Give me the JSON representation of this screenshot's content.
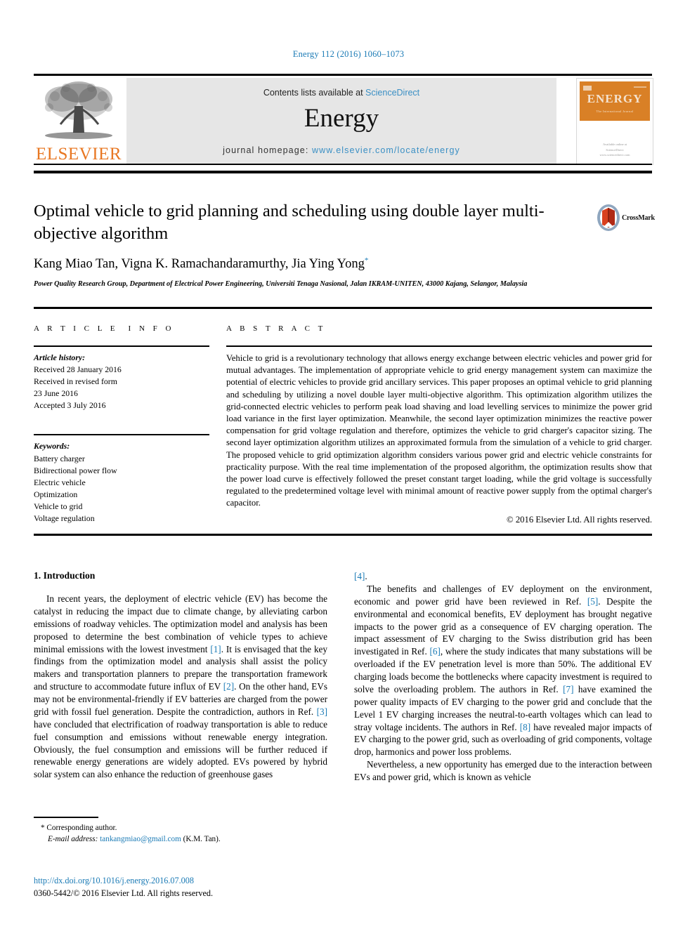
{
  "running_head": "Energy 112 (2016) 1060–1073",
  "masthead": {
    "publisher_name": "ELSEVIER",
    "contents_prefix": "Contents lists available at ",
    "sciencedirect": "ScienceDirect",
    "journal_title": "Energy",
    "homepage_prefix": "journal homepage: ",
    "homepage_url": "www.elsevier.com/locate/energy",
    "cover_title": "ENERGY",
    "cover_subtitle": "The International Journal",
    "cover_footer": "Available online at\nScienceDirect\nwww.sciencedirect.com"
  },
  "article": {
    "title": "Optimal vehicle to grid planning and scheduling using double layer multi-objective algorithm",
    "authors": "Kang Miao Tan, Vigna K. Ramachandaramurthy, Jia Ying Yong",
    "author_marker": "*",
    "affiliation": "Power Quality Research Group, Department of Electrical Power Engineering, Universiti Tenaga Nasional, Jalan IKRAM-UNITEN, 43000 Kajang, Selangor, Malaysia",
    "crossmark_label": "CrossMark"
  },
  "article_info": {
    "heading": "ARTICLE INFO",
    "history_label": "Article history:",
    "history": [
      "Received 28 January 2016",
      "Received in revised form",
      "23 June 2016",
      "Accepted 3 July 2016"
    ],
    "keywords_label": "Keywords:",
    "keywords": [
      "Battery charger",
      "Bidirectional power flow",
      "Electric vehicle",
      "Optimization",
      "Vehicle to grid",
      "Voltage regulation"
    ]
  },
  "abstract": {
    "heading": "ABSTRACT",
    "text": "Vehicle to grid is a revolutionary technology that allows energy exchange between electric vehicles and power grid for mutual advantages. The implementation of appropriate vehicle to grid energy management system can maximize the potential of electric vehicles to provide grid ancillary services. This paper proposes an optimal vehicle to grid planning and scheduling by utilizing a novel double layer multi-objective algorithm. This optimization algorithm utilizes the grid-connected electric vehicles to perform peak load shaving and load levelling services to minimize the power grid load variance in the first layer optimization. Meanwhile, the second layer optimization minimizes the reactive power compensation for grid voltage regulation and therefore, optimizes the vehicle to grid charger's capacitor sizing. The second layer optimization algorithm utilizes an approximated formula from the simulation of a vehicle to grid charger. The proposed vehicle to grid optimization algorithm considers various power grid and electric vehicle constraints for practicality purpose. With the real time implementation of the proposed algorithm, the optimization results show that the power load curve is effectively followed the preset constant target loading, while the grid voltage is successfully regulated to the predetermined voltage level with minimal amount of reactive power supply from the optimal charger's capacitor.",
    "copyright": "© 2016 Elsevier Ltd. All rights reserved."
  },
  "introduction": {
    "section_title": "1. Introduction",
    "left_para_1_a": "In recent years, the deployment of electric vehicle (EV) has become the catalyst in reducing the impact due to climate change, by alleviating carbon emissions of roadway vehicles. The optimization model and analysis has been proposed to determine the best combination of vehicle types to achieve minimal emissions with the lowest investment ",
    "ref_1": "[1]",
    "left_para_1_b": ". It is envisaged that the key findings from the optimization model and analysis shall assist the policy makers and transportation planners to prepare the transportation framework and structure to accommodate future influx of EV ",
    "ref_2": "[2]",
    "left_para_1_c": ". On the other hand, EVs may not be environmental-friendly if EV batteries are charged from the power grid with fossil fuel generation. Despite the contradiction, authors in Ref. ",
    "ref_3": "[3]",
    "left_para_1_d": " have concluded that electrification of roadway transportation is able to reduce fuel consumption and emissions without renewable energy integration. Obviously, the fuel consumption and emissions will be further reduced if renewable energy generations are widely adopted. EVs powered by hybrid solar system can also enhance the reduction of greenhouse gases ",
    "ref_4": "[4]",
    "right_para_1_end": ".",
    "right_para_2_a": "The benefits and challenges of EV deployment on the environment, economic and power grid have been reviewed in Ref. ",
    "ref_5": "[5]",
    "right_para_2_b": ". Despite the environmental and economical benefits, EV deployment has brought negative impacts to the power grid as a consequence of EV charging operation. The impact assessment of EV charging to the Swiss distribution grid has been investigated in Ref. ",
    "ref_6": "[6]",
    "right_para_2_c": ", where the study indicates that many substations will be overloaded if the EV penetration level is more than 50%. The additional EV charging loads become the bottlenecks where capacity investment is required to solve the overloading problem. The authors in Ref. ",
    "ref_7": "[7]",
    "right_para_2_d": " have examined the power quality impacts of EV charging to the power grid and conclude that the Level 1 EV charging increases the neutral-to-earth voltages which can lead to stray voltage incidents. The authors in Ref. ",
    "ref_8": "[8]",
    "right_para_2_e": " have revealed major impacts of EV charging to the power grid, such as overloading of grid components, voltage drop, harmonics and power loss problems.",
    "right_para_3": "Nevertheless, a new opportunity has emerged due to the interaction between EVs and power grid, which is known as vehicle"
  },
  "footnote": {
    "corresponding_marker": "*",
    "corresponding_label": "Corresponding author.",
    "email_label": "E-mail address:",
    "email": "tankangmiao@gmail.com",
    "email_suffix": "(K.M. Tan).",
    "doi": "http://dx.doi.org/10.1016/j.energy.2016.07.008",
    "issn_copyright": "0360-5442/© 2016 Elsevier Ltd. All rights reserved."
  },
  "colors": {
    "link_blue": "#1a7ab5",
    "elsevier_orange": "#e87722",
    "band_gray": "#e6e6e6"
  }
}
